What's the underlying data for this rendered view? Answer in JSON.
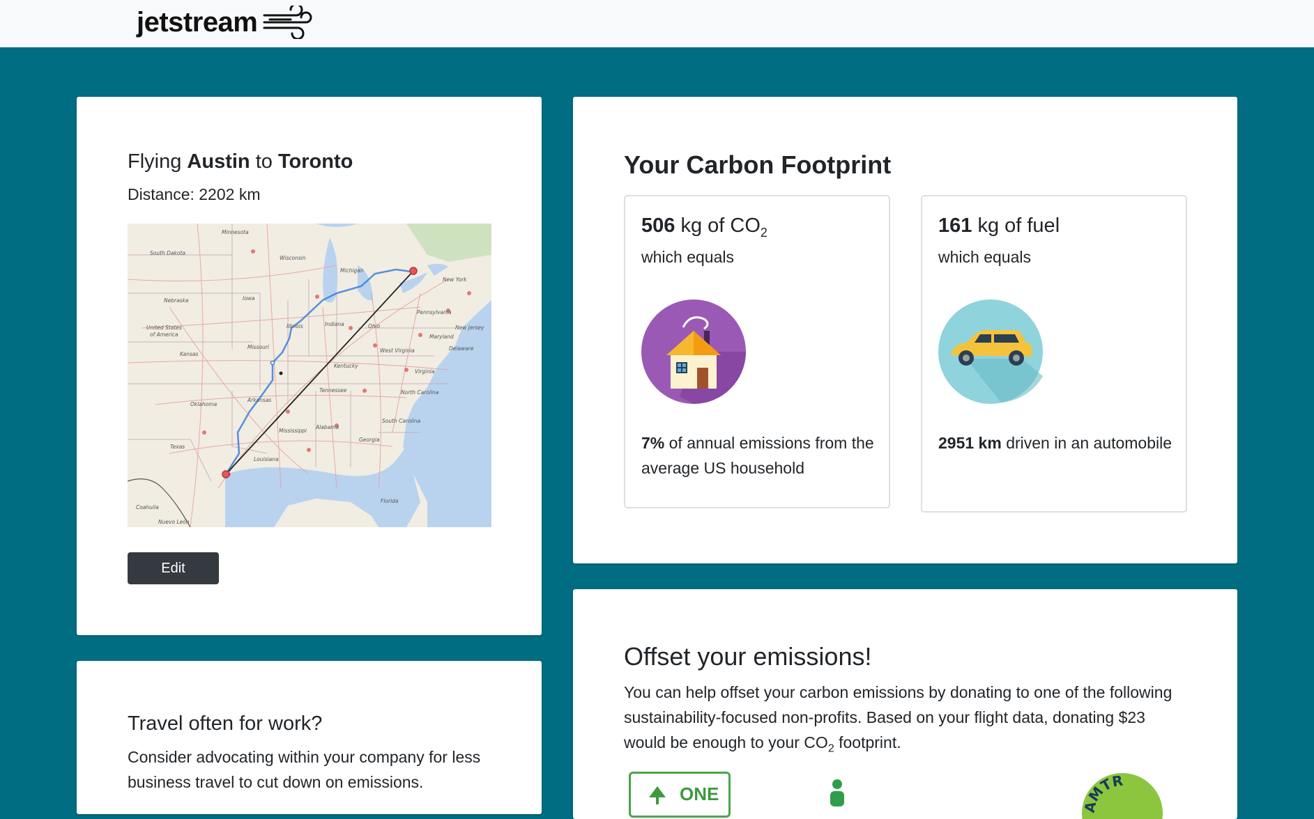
{
  "header": {
    "brand": "jetstream"
  },
  "trip": {
    "title_prefix": "Flying ",
    "origin": "Austin",
    "connector": " to ",
    "destination": "Toronto",
    "distance": "Distance: 2202 km",
    "edit_label": "Edit",
    "map_labels": [
      "Minnesota",
      "South Dakota",
      "Wisconsin",
      "Michigan",
      "Nebraska",
      "Iowa",
      "United States",
      "of America",
      "Illinois",
      "Indiana",
      "Ohio",
      "Pennsylvania",
      "New York",
      "Kansas",
      "Missouri",
      "Kentucky",
      "West Virginia",
      "Maryland",
      "Delaware",
      "New Jersey",
      "Virginia",
      "Oklahoma",
      "Arkansas",
      "Tennessee",
      "North Carolina",
      "South Carolina",
      "Mississippi",
      "Alabama",
      "Georgia",
      "Texas",
      "Louisiana",
      "Florida",
      "Coahuila",
      "Nuevo León"
    ]
  },
  "footprint": {
    "title": "Your Carbon Footprint",
    "co2": {
      "value": "506",
      "unit_prefix": " kg of CO",
      "unit_sub": "2",
      "sub": "which equals",
      "percent": "7%",
      "desc": " of annual emissions from the average US household"
    },
    "fuel": {
      "value": "161",
      "unit": " kg of fuel",
      "sub": "which equals",
      "distance": "2951 km",
      "desc": " driven in an automobile"
    }
  },
  "work": {
    "title": "Travel often for work?",
    "text": "Consider advocating within your company for less business travel to cut down on emissions."
  },
  "offset": {
    "title": "Offset your emissions!",
    "text_before": "You can help offset your carbon emissions by donating to one of the following sustainability-focused non-profits. Based on your flight data, donating $23 would be enough to your CO",
    "text_sub": "2",
    "text_after": " footprint.",
    "org1_label": "ONE",
    "org3_label": "AMTR"
  },
  "colors": {
    "background": "#016d82",
    "button": "#343a40",
    "house_bg": "#8e44ad",
    "car_bg": "#8fd3dc",
    "car": "#f5c33b",
    "route_driving": "#3b7ddd"
  }
}
